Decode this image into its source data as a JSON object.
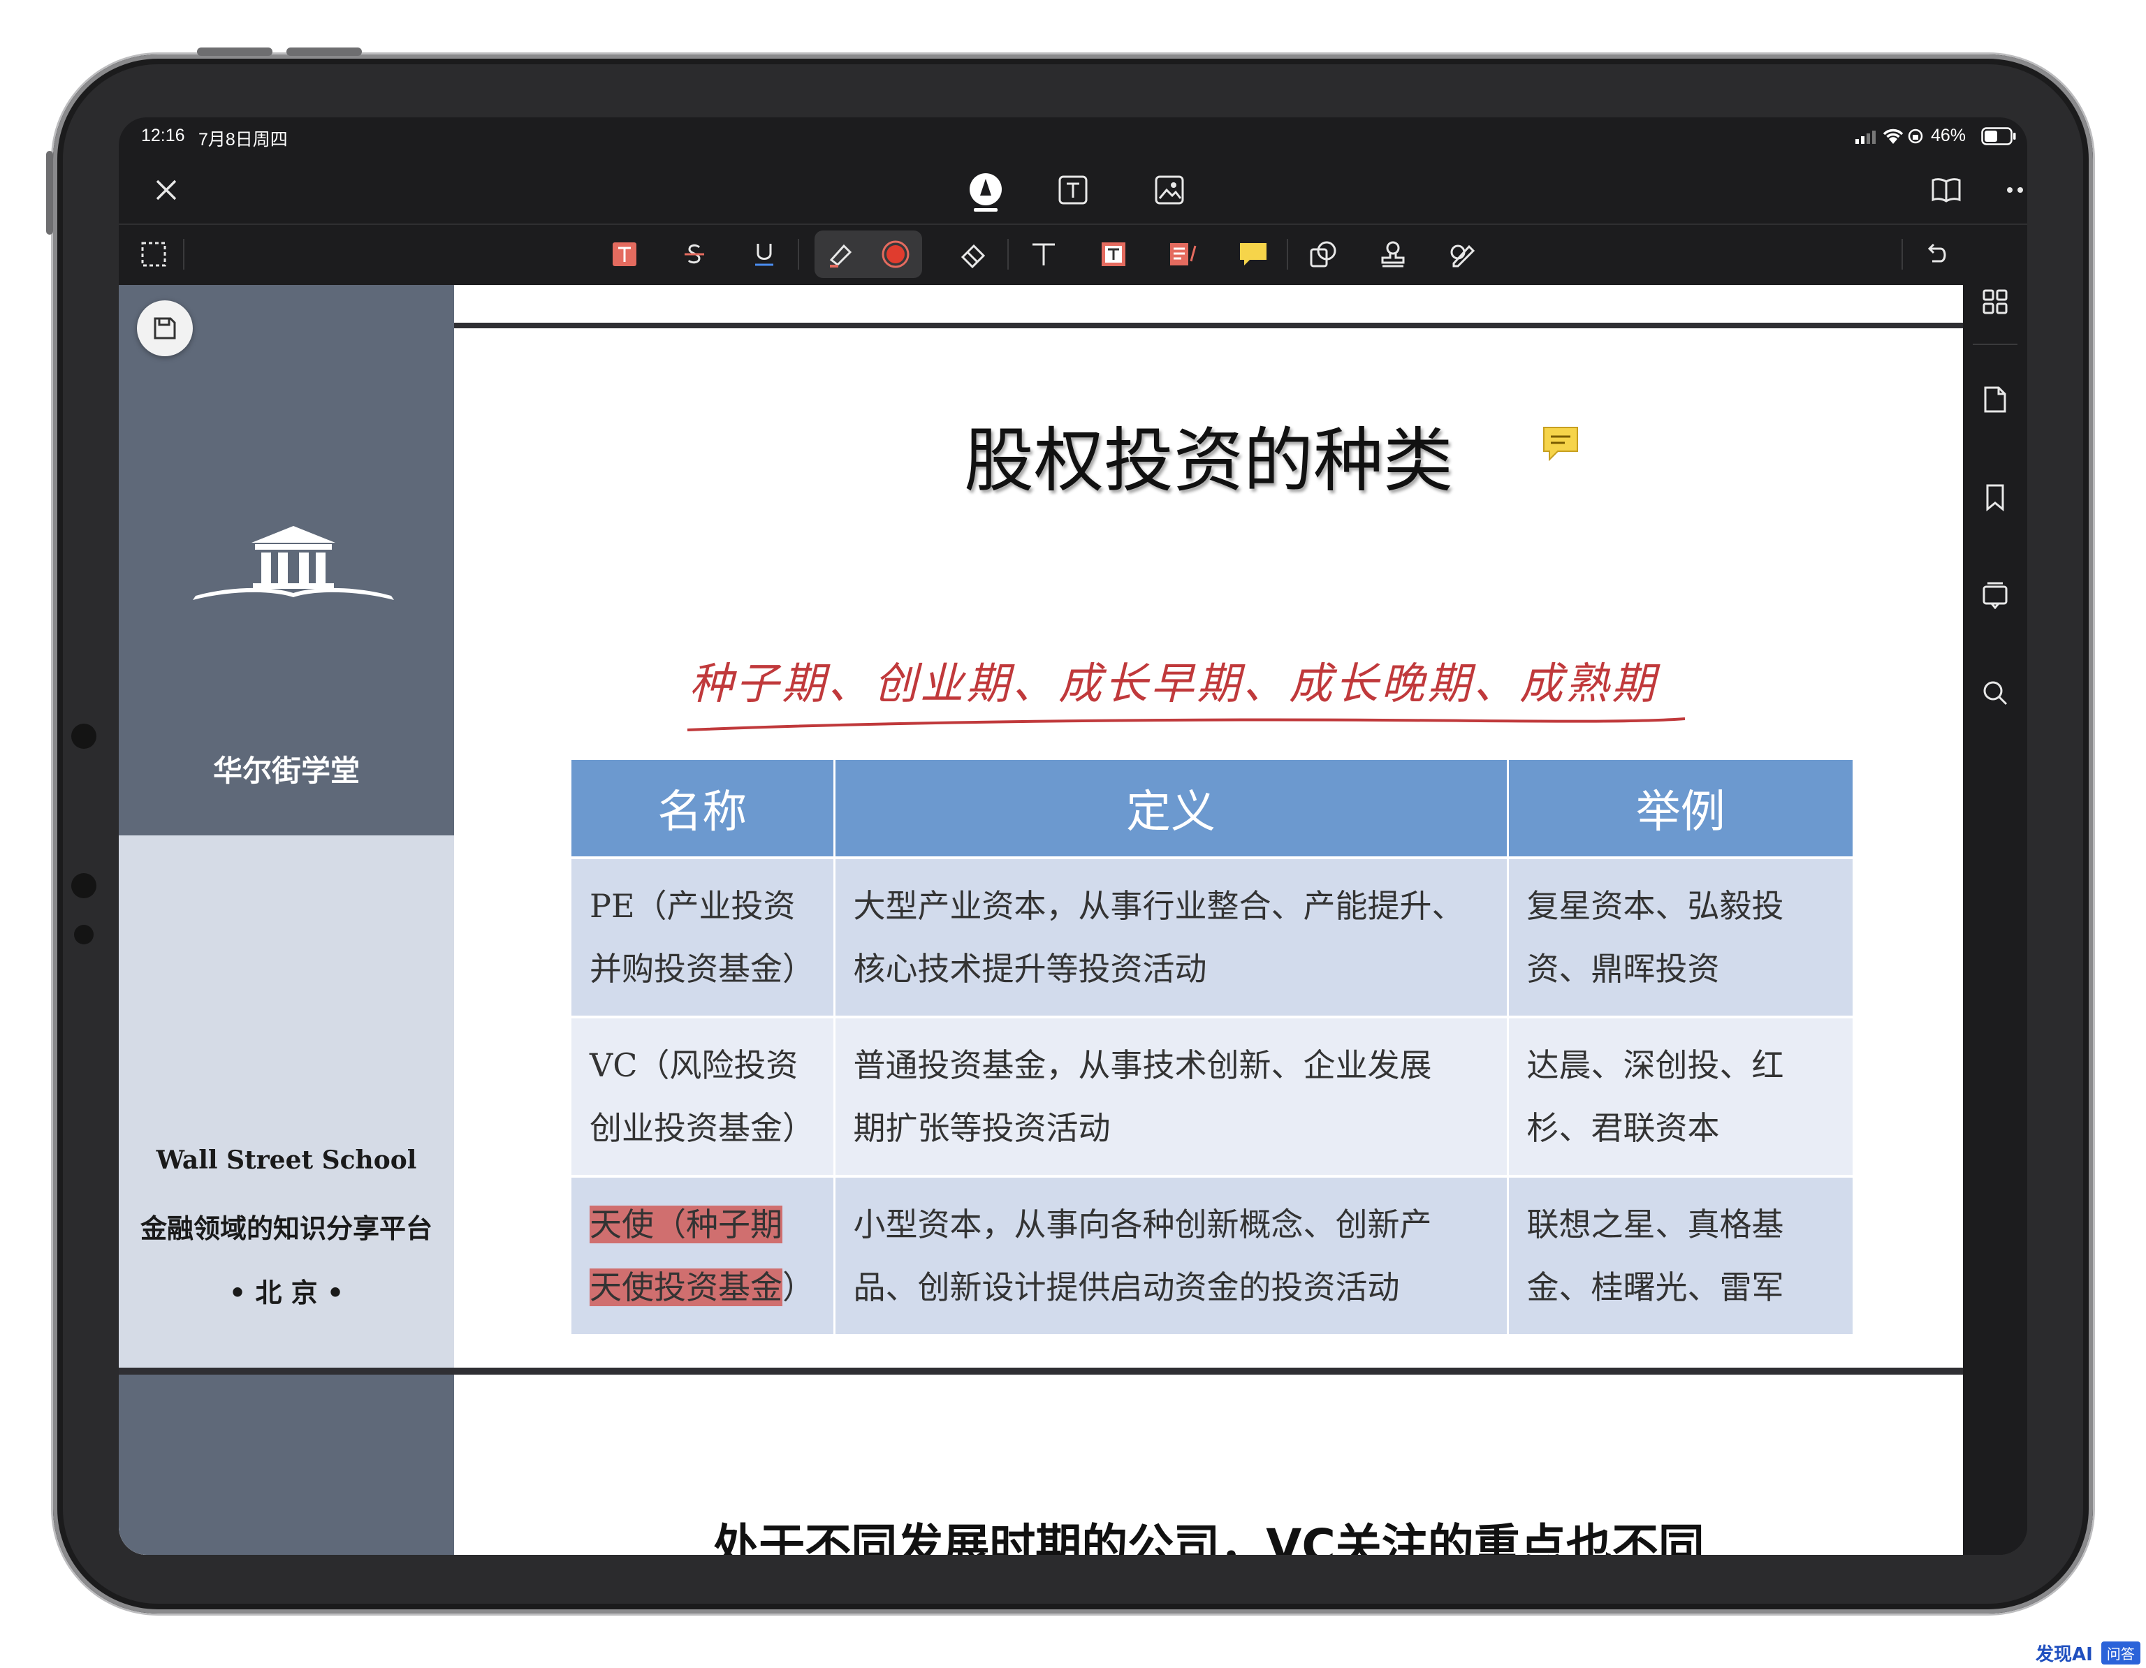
{
  "status_bar": {
    "time": "12:16",
    "date": "7月8日周四",
    "battery": "46%"
  },
  "sidebar_brand": {
    "name": "华尔街学堂",
    "school_en": "Wall Street School",
    "tagline": "金融领域的知识分享平台",
    "city": "• 北 京 •"
  },
  "slide1": {
    "title": "股权投资的种类",
    "handwriting": "种子期、创业期、成长早期、成长晚期、成熟期",
    "table": {
      "headers": [
        "名称",
        "定义",
        "举例"
      ],
      "rows": [
        {
          "name": [
            "PE（产业投资",
            "并购投资基金）"
          ],
          "definition": [
            "大型产业资本，从事行业整合、产能提升、",
            "核心技术提升等投资活动"
          ],
          "example": [
            "复星资本、弘毅投",
            "资、鼎晖投资"
          ]
        },
        {
          "name": [
            "VC（风险投资",
            "创业投资基金）"
          ],
          "definition": [
            "普通投资基金，从事技术创新、企业发展",
            "期扩张等投资活动"
          ],
          "example": [
            "达晨、深创投、红",
            "杉、君联资本"
          ]
        },
        {
          "name_highlight": [
            "天使（种子期",
            "天使投资基金"
          ],
          "name_tail": "）",
          "definition": [
            "小型资本，从事向各种创新概念、创新产",
            "品、创新设计提供启动资金的投资活动"
          ],
          "example": [
            "联想之星、真格基",
            "金、桂曙光、雷军"
          ]
        }
      ]
    }
  },
  "slide2": {
    "title": "处于不同发展时期的公司，VC关注的重点也不同"
  },
  "watermark": {
    "brand": "发现AI",
    "tag": "问答"
  },
  "colors": {
    "header_blue": "#6c99cf",
    "highlight_red": "#d06f6f",
    "ink_red": "#c0393b",
    "sidebar_dark": "#5f6979",
    "sidebar_light": "#d5dbe6"
  }
}
